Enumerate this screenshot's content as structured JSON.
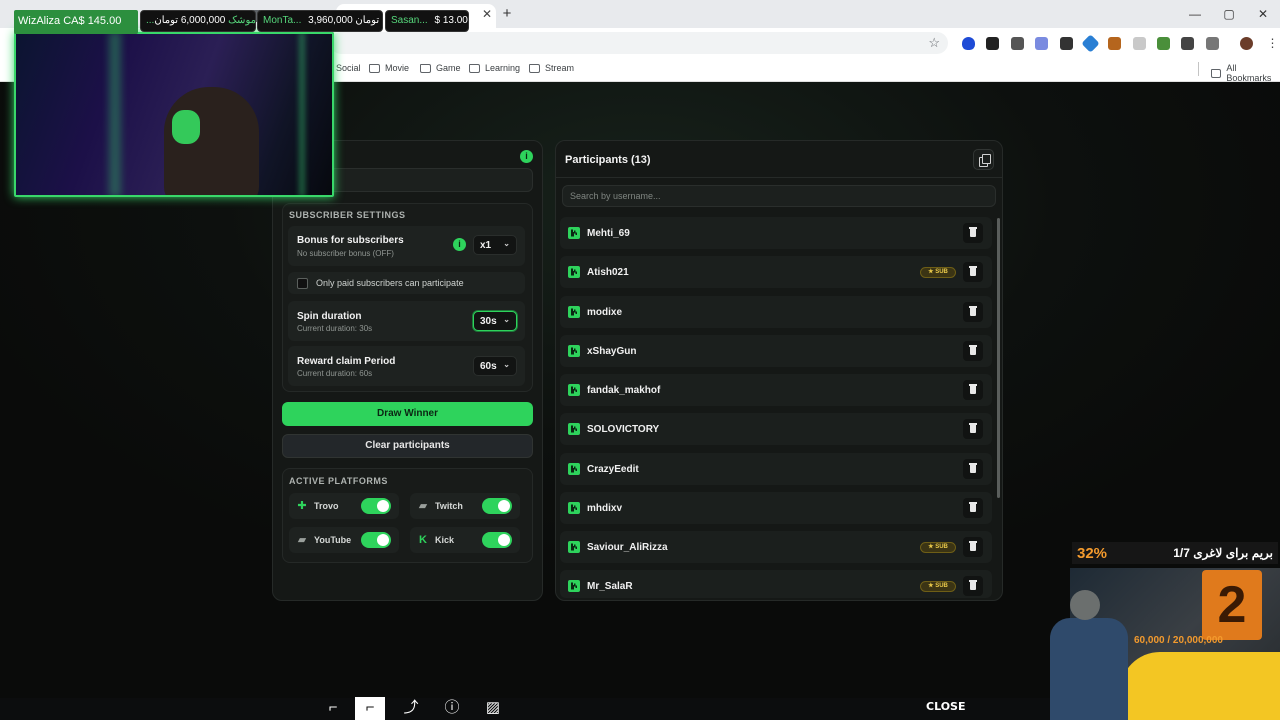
{
  "stream_ticker": [
    {
      "name": "WizAliza",
      "amount": "CA$ 145.00"
    },
    {
      "name": "...موشک",
      "amount": "6,000,000 تومان"
    },
    {
      "name": "MonTa...",
      "amount": "3,960,000 تومان"
    },
    {
      "name": "Sasan...",
      "amount": "$ 13.00"
    }
  ],
  "browser": {
    "bookmarks": [
      "Social",
      "Movie",
      "Game",
      "Learning",
      "Stream"
    ],
    "all_bookmarks": "All Bookmarks"
  },
  "left_panel": {
    "subscriber_settings_title": "SUBSCRIBER SETTINGS",
    "bonus": {
      "title": "Bonus for subscribers",
      "subtitle": "No subscriber bonus (OFF)",
      "value": "x1"
    },
    "paid_only_label": "Only paid subscribers can participate",
    "spin": {
      "title": "Spin duration",
      "subtitle": "Current duration: 30s",
      "value": "30s"
    },
    "reward": {
      "title": "Reward claim Period",
      "subtitle": "Current duration: 60s",
      "value": "60s"
    },
    "draw_button": "Draw Winner",
    "clear_button": "Clear participants",
    "platforms_title": "ACTIVE PLATFORMS",
    "platforms": [
      {
        "label": "Trovo",
        "enabled": true,
        "icon": "trovo-icon"
      },
      {
        "label": "Twitch",
        "enabled": true,
        "icon": "twitch-icon"
      },
      {
        "label": "YouTube",
        "enabled": true,
        "icon": "youtube-icon"
      },
      {
        "label": "Kick",
        "enabled": true,
        "icon": "kick-icon"
      }
    ],
    "accent": "#2ed35c"
  },
  "participants": {
    "title": "Participants (13)",
    "search_placeholder": "Search by username...",
    "sub_badge": "SUB",
    "list": [
      {
        "name": "Mehti_69",
        "sub": false
      },
      {
        "name": "Atish021",
        "sub": true
      },
      {
        "name": "modixe",
        "sub": false
      },
      {
        "name": "xShayGun",
        "sub": false
      },
      {
        "name": "fandak_makhof",
        "sub": false
      },
      {
        "name": "SOLOVICTORY",
        "sub": false
      },
      {
        "name": "CrazyEedit",
        "sub": false
      },
      {
        "name": "mhdixv",
        "sub": false
      },
      {
        "name": "Saviour_AliRizza",
        "sub": true
      },
      {
        "name": "Mr_SalaR",
        "sub": true
      }
    ]
  },
  "overlay": {
    "goal_percent": "32%",
    "goal_title": "بریم برای لاغری 1/7",
    "goal_number": "2",
    "goal_amount": "60,000 / 20,000,000",
    "close_label": "CLOSE"
  }
}
